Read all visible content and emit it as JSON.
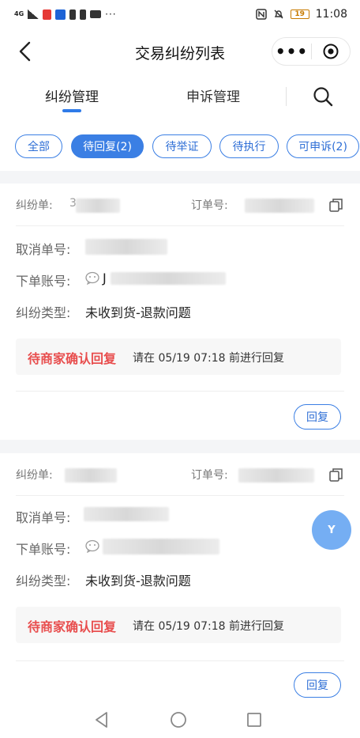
{
  "status_bar": {
    "network": "4G",
    "battery": "19",
    "time": "11:08",
    "dots": "···"
  },
  "nav": {
    "title": "交易纠纷列表",
    "more": "•••"
  },
  "tabs": [
    {
      "label": "纠纷管理",
      "active": true
    },
    {
      "label": "申诉管理",
      "active": false
    }
  ],
  "filters": [
    {
      "label": "全部",
      "active": false
    },
    {
      "label": "待回复(2)",
      "active": true
    },
    {
      "label": "待举证",
      "active": false
    },
    {
      "label": "待执行",
      "active": false
    },
    {
      "label": "可申诉(2)",
      "active": false
    }
  ],
  "cards": [
    {
      "dispute_no_label": "纠纷单:",
      "dispute_no_prefix": "3",
      "order_no_label": "订单号:",
      "cancel_no_label": "取消单号:",
      "account_label": "下单账号:",
      "account_prefix": "J",
      "type_label": "纠纷类型:",
      "type_value": "未收到货-退款问题",
      "notice_title": "待商家确认回复",
      "notice_text": "请在 05/19 07:18 前进行回复",
      "reply_label": "回复"
    },
    {
      "dispute_no_label": "纠纷单:",
      "dispute_no_prefix": "",
      "order_no_label": "订单号:",
      "cancel_no_label": "取消单号:",
      "account_label": "下单账号:",
      "account_prefix": "",
      "type_label": "纠纷类型:",
      "type_value": "未收到货-退款问题",
      "notice_title": "待商家确认回复",
      "notice_text": "请在 05/19 07:18 前进行回复",
      "reply_label": "回复"
    }
  ],
  "float_avatar": {
    "letter": "Y"
  },
  "colors": {
    "accent": "#3b7fe4",
    "warning": "#e84e4e",
    "avatar": "#75aef3"
  }
}
